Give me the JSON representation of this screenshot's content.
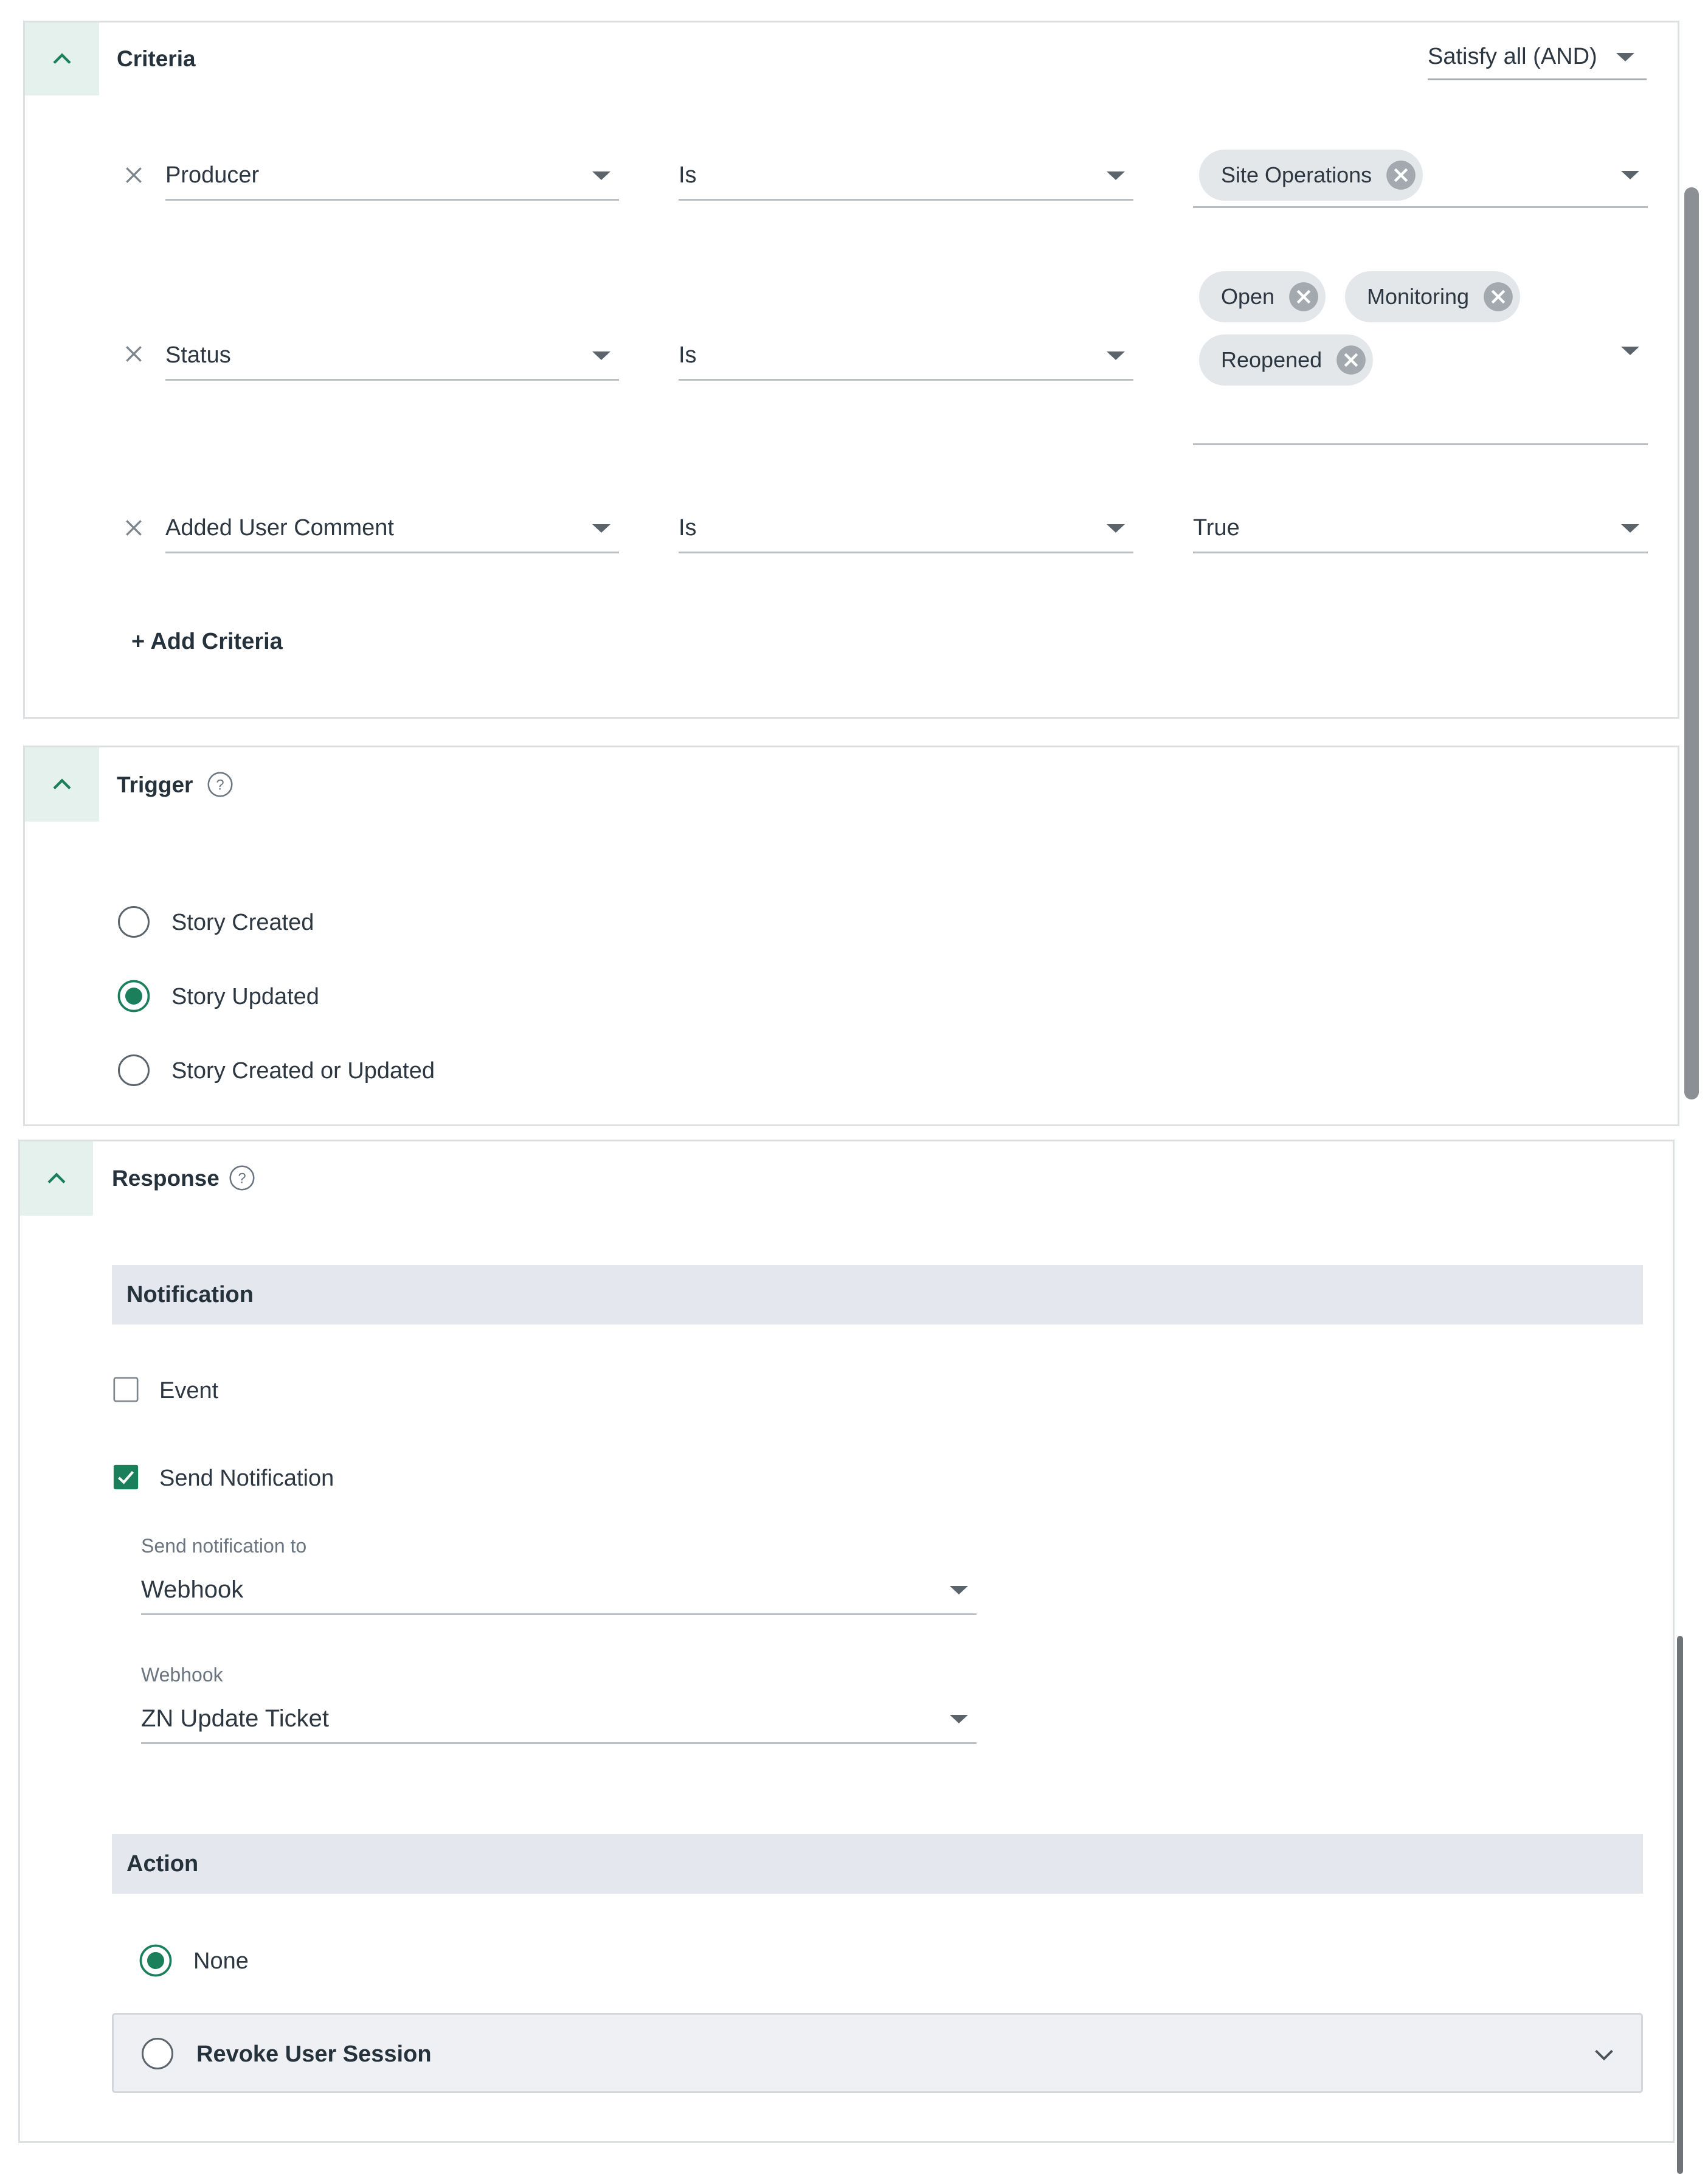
{
  "criteria": {
    "title": "Criteria",
    "match_mode": "Satisfy all (AND)",
    "rows": [
      {
        "field": "Producer",
        "operator": "Is",
        "values": [
          "Site Operations"
        ]
      },
      {
        "field": "Status",
        "operator": "Is",
        "values": [
          "Open",
          "Monitoring",
          "Reopened"
        ]
      },
      {
        "field": "Added User Comment",
        "operator": "Is",
        "value": "True"
      }
    ],
    "add_label": "+ Add Criteria"
  },
  "trigger": {
    "title": "Trigger",
    "options": [
      {
        "label": "Story Created",
        "selected": false
      },
      {
        "label": "Story Updated",
        "selected": true
      },
      {
        "label": "Story Created or Updated",
        "selected": false
      }
    ]
  },
  "response": {
    "title": "Response",
    "notification": {
      "heading": "Notification",
      "event_label": "Event",
      "event_checked": false,
      "send_label": "Send Notification",
      "send_checked": true,
      "send_to_label": "Send notification to",
      "send_to_value": "Webhook",
      "webhook_label": "Webhook",
      "webhook_value": "ZN Update Ticket"
    },
    "action": {
      "heading": "Action",
      "options": [
        {
          "label": "None",
          "selected": true
        },
        {
          "label": "Revoke User Session",
          "selected": false
        }
      ]
    }
  },
  "colors": {
    "accent": "#1a7f5a",
    "accent_light": "#e5f1ec",
    "section_bg": "#e4e7ed",
    "chip_bg": "#e4e7ea",
    "border": "#dde0e3",
    "scrollbar": "#8c9094"
  }
}
